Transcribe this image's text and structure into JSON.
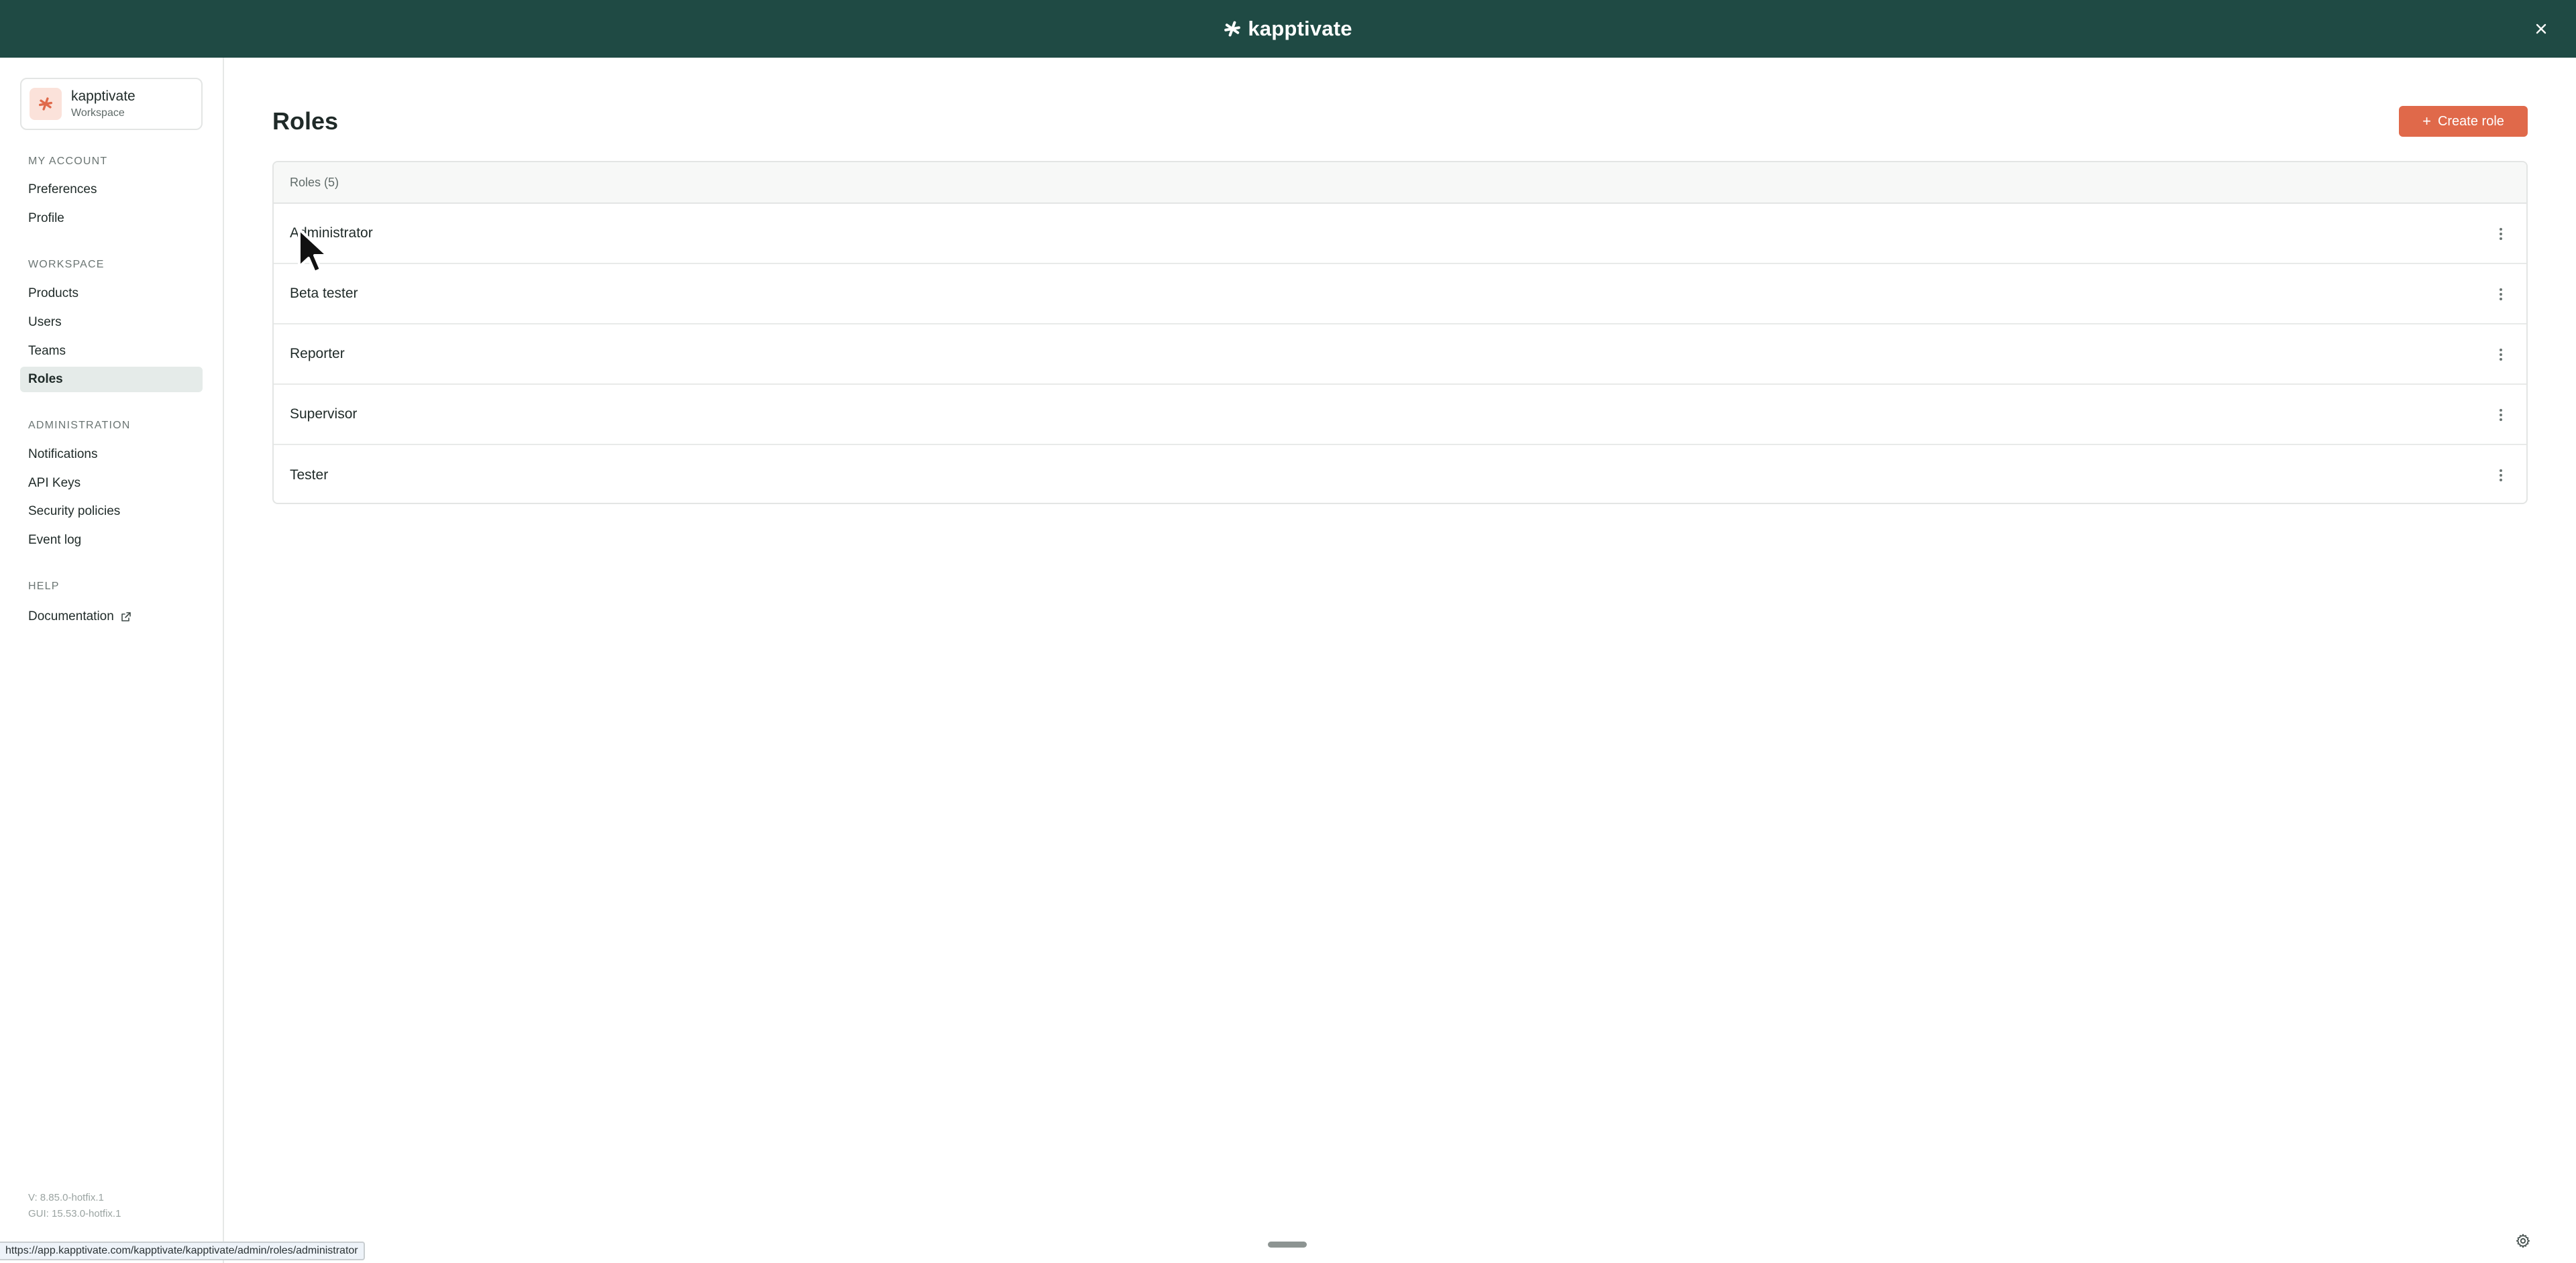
{
  "app": {
    "brand": "kapptivate",
    "colors": {
      "topbar": "#1f4a44",
      "accent": "#e0694a",
      "active_nav": "#e5ebe9"
    }
  },
  "workspace": {
    "name": "kapptivate",
    "subtitle": "Workspace"
  },
  "sidebar": {
    "sections": [
      {
        "label": "MY ACCOUNT",
        "items": [
          {
            "label": "Preferences"
          },
          {
            "label": "Profile"
          }
        ]
      },
      {
        "label": "WORKSPACE",
        "items": [
          {
            "label": "Products"
          },
          {
            "label": "Users"
          },
          {
            "label": "Teams"
          },
          {
            "label": "Roles",
            "active": true
          }
        ]
      },
      {
        "label": "ADMINISTRATION",
        "items": [
          {
            "label": "Notifications"
          },
          {
            "label": "API Keys"
          },
          {
            "label": "Security policies"
          },
          {
            "label": "Event log"
          }
        ]
      },
      {
        "label": "HELP",
        "items": [
          {
            "label": "Documentation",
            "icon": "external-link-icon"
          }
        ]
      }
    ],
    "version": {
      "v": "V: 8.85.0-hotfix.1",
      "gui": "GUI: 15.53.0-hotfix.1"
    }
  },
  "main": {
    "title": "Roles",
    "create_button": "Create role",
    "table": {
      "header": "Roles (5)",
      "rows": [
        "Administrator",
        "Beta tester",
        "Reporter",
        "Supervisor",
        "Tester"
      ]
    }
  },
  "status_url": "https://app.kapptivate.com/kapptivate/kapptivate/admin/roles/administrator"
}
